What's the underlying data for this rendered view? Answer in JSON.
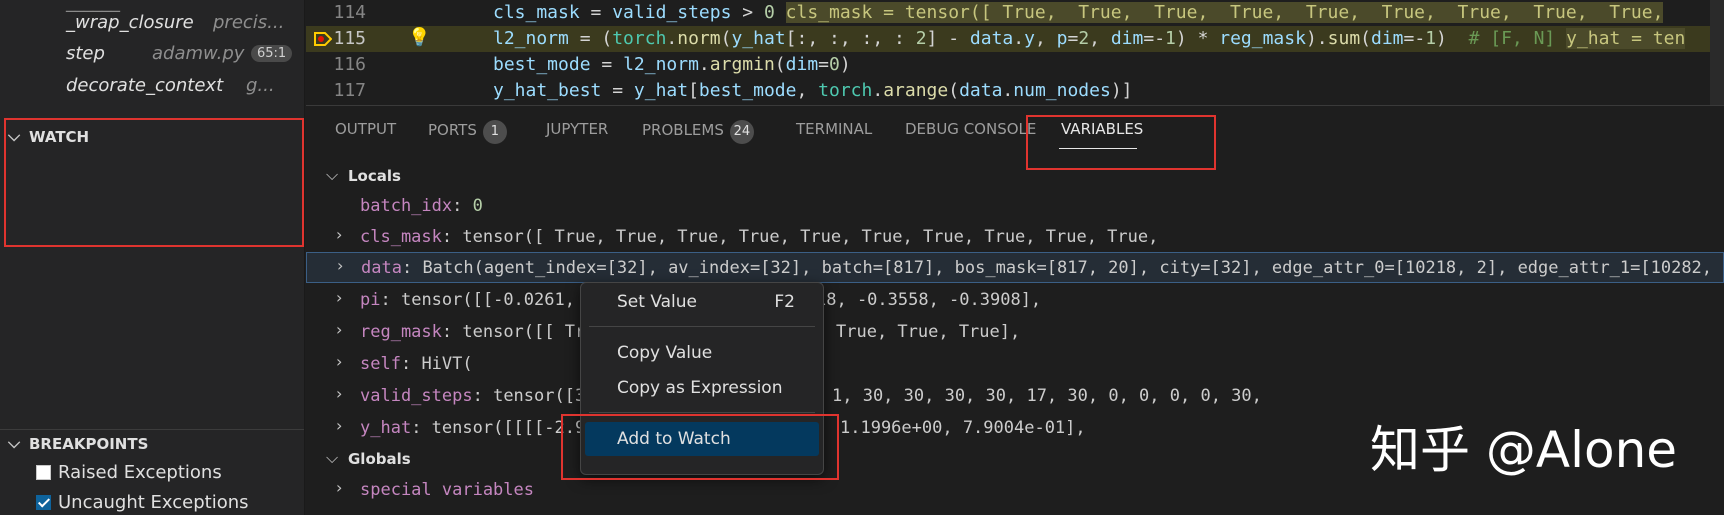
{
  "sidebar": {
    "call_stack": [
      {
        "fn": "_wrap_closure",
        "file": "precis..."
      },
      {
        "fn": "step",
        "file": "adamw.py",
        "line": "65:1"
      },
      {
        "fn": "decorate_context",
        "file": "g..."
      }
    ],
    "watch_title": "WATCH",
    "breakpoints_title": "BREAKPOINTS",
    "breakpoints": [
      {
        "label": "Raised Exceptions",
        "checked": false
      },
      {
        "label": "Uncaught Exceptions",
        "checked": true
      }
    ]
  },
  "editor": {
    "lines": [
      {
        "num": "114",
        "code": "cls_mask = valid_steps > 0",
        "inline": "cls_mask = tensor([ True,  True,  True,  True,  True,  True,  True,  True,  True,"
      },
      {
        "num": "115",
        "code": "l2_norm = (torch.norm(y_hat[:, :, :, : 2] - data.y, p=2, dim=-1) * reg_mask).sum(dim=-1)  # [F, N]",
        "inline": "y_hat = ten",
        "current": true
      },
      {
        "num": "116",
        "code": "best_mode = l2_norm.argmin(dim=0)"
      },
      {
        "num": "117",
        "code": "y_hat_best = y_hat[best_mode, torch.arange(data.num_nodes)]"
      }
    ]
  },
  "panel": {
    "tabs": [
      {
        "label": "OUTPUT"
      },
      {
        "label": "PORTS",
        "badge": "1"
      },
      {
        "label": "JUPYTER"
      },
      {
        "label": "PROBLEMS",
        "badge": "24"
      },
      {
        "label": "TERMINAL"
      },
      {
        "label": "DEBUG CONSOLE"
      },
      {
        "label": "VARIABLES",
        "active": true
      }
    ],
    "locals_title": "Locals",
    "globals_title": "Globals",
    "variables": [
      {
        "name": "batch_idx",
        "value": "0",
        "expandable": false
      },
      {
        "name": "cls_mask",
        "value": "tensor([ True,  True,  True,  True,  True,  True,  True,  True,  True,  True,",
        "expandable": true
      },
      {
        "name": "data",
        "value": "Batch(agent_index=[32], av_index=[32], batch=[817], bos_mask=[817, 20], city=[32], edge_attr_0=[10218, 2], edge_attr_1=[10282,",
        "expandable": true,
        "selected": true
      },
      {
        "name": "pi",
        "value": "tensor([[-0.0261,",
        "tail": "18, -0.3558, -0.3908],",
        "expandable": true
      },
      {
        "name": "reg_mask",
        "value": "tensor([[ Tr",
        "tail": "True,  True,  True],",
        "expandable": true
      },
      {
        "name": "self",
        "value": "HiVT(",
        "expandable": true
      },
      {
        "name": "valid_steps",
        "value": "tensor([3",
        "tail": "1, 30, 30, 30, 30, 17, 30,  0,  0,  0,  0, 30,",
        "expandable": true
      },
      {
        "name": "y_hat",
        "value": "tensor([[[[-2.9",
        "tail": "1.1996e+00,  7.9004e-01],",
        "expandable": true
      }
    ],
    "globals": [
      {
        "name": "special variables"
      }
    ]
  },
  "context_menu": {
    "items": [
      {
        "label": "Set Value",
        "key": "F2"
      },
      {
        "label": "Copy Value"
      },
      {
        "label": "Copy as Expression"
      },
      {
        "label": "Add to Watch",
        "highlight": true
      }
    ]
  },
  "watermark": "知乎 @Alone"
}
